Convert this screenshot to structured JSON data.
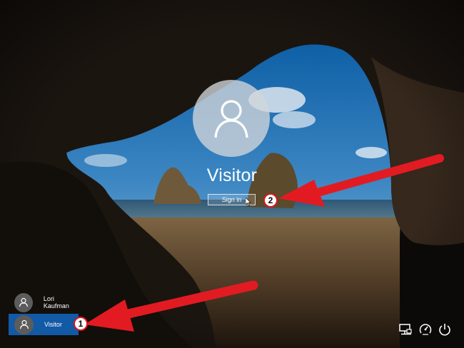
{
  "login": {
    "current_user": "Visitor",
    "signin_label": "Sign in"
  },
  "user_list": [
    {
      "name": "Lori Kaufman",
      "selected": false
    },
    {
      "name": "Visitor",
      "selected": true
    }
  ],
  "system_icons": [
    "network-icon",
    "ease-of-access-icon",
    "power-icon"
  ],
  "annotations": {
    "callout_1": "1",
    "callout_2": "2",
    "arrow_color": "#e21b22"
  },
  "colors": {
    "selected_user_bg": "#1259a6",
    "text": "#ffffff"
  }
}
